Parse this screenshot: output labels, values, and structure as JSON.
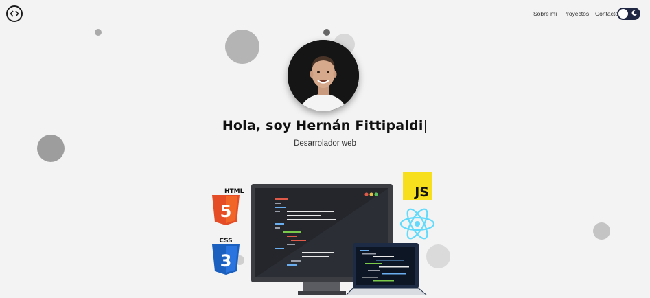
{
  "nav": {
    "items": [
      "Sobre mí",
      "Proyectos",
      "Contacto"
    ],
    "separator": "·"
  },
  "theme_toggle": {
    "state": "dark-mode-off",
    "icon": "moon-icon"
  },
  "hero": {
    "name_line": "Hola, soy Hernán Fittipaldi",
    "cursor": "|",
    "role": "Desarrolador web"
  },
  "tech_badges": {
    "html_label": "HTML",
    "html_number": "5",
    "css_label": "CSS",
    "css_number": "3",
    "js_label": "JS"
  },
  "colors": {
    "html_orange": "#e44d26",
    "css_blue": "#2a65f0",
    "js_yellow": "#f7df1e",
    "react_cyan": "#61dafb",
    "toggle_navy": "#202742"
  }
}
